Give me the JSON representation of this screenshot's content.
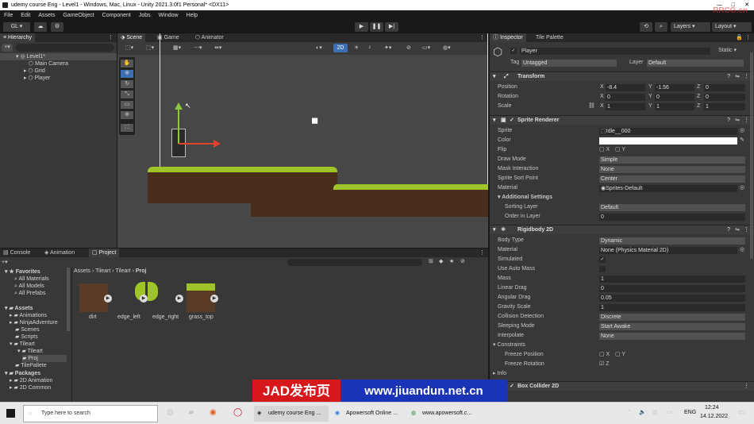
{
  "window": {
    "title": "udemy course Eng - Level1 - Windows, Mac, Linux - Unity 2021.3.0f1 Personal* <DX11>"
  },
  "menu": [
    "File",
    "Edit",
    "Assets",
    "GameObject",
    "Component",
    "Jobs",
    "Window",
    "Help"
  ],
  "toolbar": {
    "account": "GL",
    "layers": "Layers",
    "layout": "Layout"
  },
  "hierarchy": {
    "tab": "Hierarchy",
    "scene": "Level1*",
    "items": [
      "Main Camera",
      "Grid",
      "Player"
    ]
  },
  "scene": {
    "tabs": [
      "Scene",
      "Game",
      "Animator"
    ],
    "mode_2d": "2D"
  },
  "bottom": {
    "tabs": [
      "Console",
      "Animation",
      "Project"
    ],
    "favorites": {
      "label": "Favorites",
      "items": [
        "All Materials",
        "All Models",
        "All Prefabs"
      ]
    },
    "assets": {
      "label": "Assets",
      "items": [
        "Animations",
        "NinjaAdventure",
        "Scenes",
        "Scripts",
        "Tileart",
        "Tileart",
        "Proj",
        "TilePallete"
      ]
    },
    "packages": {
      "label": "Packages",
      "items": [
        "2D Animation",
        "2D Common"
      ]
    },
    "breadcrumb": [
      "Assets",
      "Tileart",
      "Tileart",
      "Proj"
    ],
    "files": [
      "dirt",
      "edge_left",
      "edge_right",
      "grass_top"
    ]
  },
  "inspector": {
    "tabs": [
      "Inspector",
      "Tile Palette"
    ],
    "object": {
      "name": "Player",
      "static": "Static",
      "tag_label": "Tag",
      "tag": "Untagged",
      "layer_label": "Layer",
      "layer": "Default"
    },
    "transform": {
      "title": "Transform",
      "position_label": "Position",
      "rotation_label": "Rotation",
      "scale_label": "Scale",
      "position": {
        "x": "-8.4",
        "y": "-1.56",
        "z": "0"
      },
      "rotation": {
        "x": "0",
        "y": "0",
        "z": "0"
      },
      "scale": {
        "x": "1",
        "y": "1",
        "z": "1"
      }
    },
    "sprite_renderer": {
      "title": "Sprite Renderer",
      "sprite_label": "Sprite",
      "sprite": "Idle__000",
      "color_label": "Color",
      "flip_label": "Flip",
      "draw_mode_label": "Draw Mode",
      "draw_mode": "Simple",
      "mask_label": "Mask Interaction",
      "mask": "None",
      "sort_point_label": "Sprite Sort Point",
      "sort_point": "Center",
      "material_label": "Material",
      "material": "Sprites-Default",
      "additional_label": "Additional Settings",
      "sorting_layer_label": "Sorting Layer",
      "sorting_layer": "Default",
      "order_label": "Order in Layer",
      "order": "0"
    },
    "rigidbody": {
      "title": "Rigidbody 2D",
      "body_type_label": "Body Type",
      "body_type": "Dynamic",
      "material_label": "Material",
      "material": "None (Physics Material 2D)",
      "simulated_label": "Simulated",
      "auto_mass_label": "Use Auto Mass",
      "mass_label": "Mass",
      "mass": "1",
      "linear_drag_label": "Linear Drag",
      "linear_drag": "0",
      "angular_drag_label": "Angular Drag",
      "angular_drag": "0.05",
      "gravity_label": "Gravity Scale",
      "gravity": "1",
      "collision_label": "Collision Detection",
      "collision": "Discrete",
      "sleeping_label": "Sleeping Mode",
      "sleeping": "Start Awake",
      "interpolate_label": "Interpolate",
      "interpolate": "None",
      "constraints_label": "Constraints",
      "freeze_pos_label": "Freeze Position",
      "freeze_rot_label": "Freeze Rotation",
      "info_label": "Info"
    },
    "box_collider": {
      "title": "Box Collider 2D"
    }
  },
  "taskbar": {
    "search": "Type here to search",
    "apps": [
      "udemy course Eng ...",
      "Apowersoft Online ...",
      "www.apowersoft.c..."
    ],
    "lang": "ENG",
    "time": "12:24",
    "date": "14.12.2022"
  },
  "watermark": {
    "banner": "JAD发布页",
    "url": "www.jiuandun.net.cn",
    "corner": "RRCG.cn"
  }
}
